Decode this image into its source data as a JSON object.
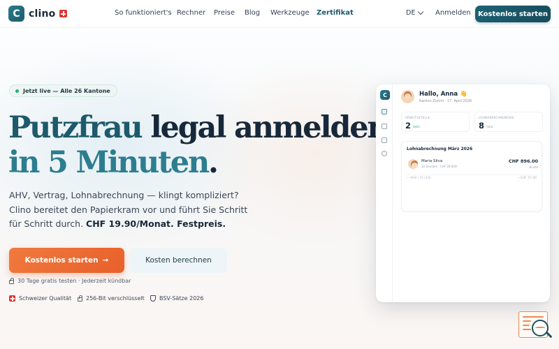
{
  "brand": {
    "name": "clino",
    "logo_letter": "C"
  },
  "nav": {
    "items": [
      "So funktioniert's",
      "Rechner",
      "Preise",
      "Blog",
      "Werkzeuge",
      "Zertifikat"
    ],
    "language": "DE",
    "login": "Anmelden",
    "cta": "Kostenlos starten"
  },
  "hero": {
    "badge": "Jetzt live — Alle 26 Kantone",
    "title_line1_a": "Putzfrau",
    "title_line1_b": " legal anmelden",
    "title_line2_a": "in 5 Minuten",
    "title_line2_b": ".",
    "lead_1": "AHV, Vertrag, Lohnabrechnung — klingt kompliziert?",
    "lead_2": "Clino bereitet den Papierkram vor und führt Sie Schritt",
    "lead_3": "für Schritt durch. ",
    "lead_strong": "CHF 19.90/Monat. Festpreis.",
    "primary_cta": "Kostenlos starten",
    "primary_cta_arrow": "→",
    "secondary_cta": "Kosten berechnen",
    "trial_note": "30 Tage gratis testen · Jederzeit kündbar",
    "trust": [
      "Schweizer Qualität",
      "256-Bit verschlüsselt",
      "BSV-Sätze 2026"
    ]
  },
  "mockup": {
    "logo_letter": "C",
    "greeting": "Hallo, Anna 👋",
    "greeting_sub": "Kanton Zürich · 17. April 2026",
    "stats": [
      {
        "label": "ARBEITSSTELLE",
        "value": "2",
        "sub": "aktiv"
      },
      {
        "label": "LOHNABRECHNUNGEN",
        "value": "8",
        "sub": "total"
      }
    ],
    "payroll": {
      "title": "Lohnabrechnung März 2026",
      "employee": "Maria Silva",
      "employee_meta": "32 Stunden · CHF 28.00/h",
      "amount": "CHF 896.00",
      "amount_sub": "Brutto",
      "deduction_label": "− AHV / IV / EO",
      "deduction_amount": "−CHF 47.49"
    }
  },
  "colors": {
    "brand": "#1d5a6b",
    "accent": "#e8602a",
    "flag": "#e0352e"
  },
  "icons": [
    "swiss-flag-icon",
    "chevron-down-icon",
    "arrow-right-icon",
    "lock-icon",
    "shield-icon",
    "home-icon",
    "people-icon",
    "document-icon",
    "settings-icon",
    "search-widget-icon"
  ]
}
